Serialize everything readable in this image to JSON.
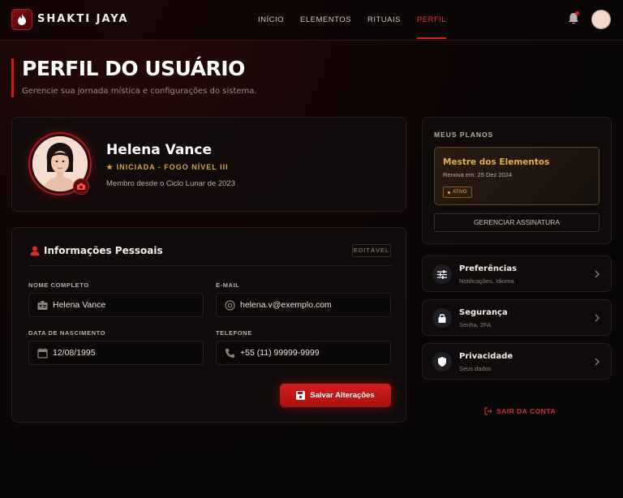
{
  "header": {
    "brand": "SHAKTI JAYA",
    "nav": [
      {
        "label": "INÍCIO",
        "active": false
      },
      {
        "label": "ELEMENTOS",
        "active": false
      },
      {
        "label": "RITUAIS",
        "active": false
      },
      {
        "label": "PERFIL",
        "active": true
      }
    ],
    "icons": {
      "logo": "flame-icon",
      "notifications": "bell-icon",
      "avatar": "user-avatar"
    }
  },
  "page": {
    "title": "PERFIL DO USUÁRIO",
    "subtitle": "Gerencie sua jornada mística e configurações do sistema."
  },
  "profile": {
    "name": "Helena Vance",
    "rank": "INICIADA - FOGO NÍVEL III",
    "since": "Membro desde o Ciclo Lunar de 2023"
  },
  "personal_info": {
    "title": "Informações Pessoais",
    "edit_badge": "EDITÁVEL",
    "fields": {
      "full_name": {
        "label": "NOME COMPLETO",
        "value": "Helena Vance"
      },
      "email": {
        "label": "E-MAIL",
        "value": "helena.v@exemplo.com"
      },
      "birth_date": {
        "label": "DATA DE NASCIMENTO",
        "value": "12/08/1995"
      },
      "phone": {
        "label": "TELEFONE",
        "value": "+55 (11) 99999-9999"
      }
    },
    "save_label": "Salvar Alterações"
  },
  "plans": {
    "title": "MEUS PLANOS",
    "plan_name": "Mestre dos Elementos",
    "renew": "Renova em: 25 Dez 2024",
    "status": "ATIVO",
    "manage_label": "GERENCIAR ASSINATURA"
  },
  "settings": [
    {
      "title": "Preferências",
      "subtitle": "Notificações, Idioma",
      "icon": "sliders-icon"
    },
    {
      "title": "Segurança",
      "subtitle": "Senha, 2FA",
      "icon": "lock-icon"
    },
    {
      "title": "Privacidade",
      "subtitle": "Seus dados",
      "icon": "shield-icon"
    }
  ],
  "logout_label": "SAIR DA CONTA",
  "colors": {
    "accent": "#d41e1e",
    "gold": "#e0b040",
    "background": "#080606"
  }
}
